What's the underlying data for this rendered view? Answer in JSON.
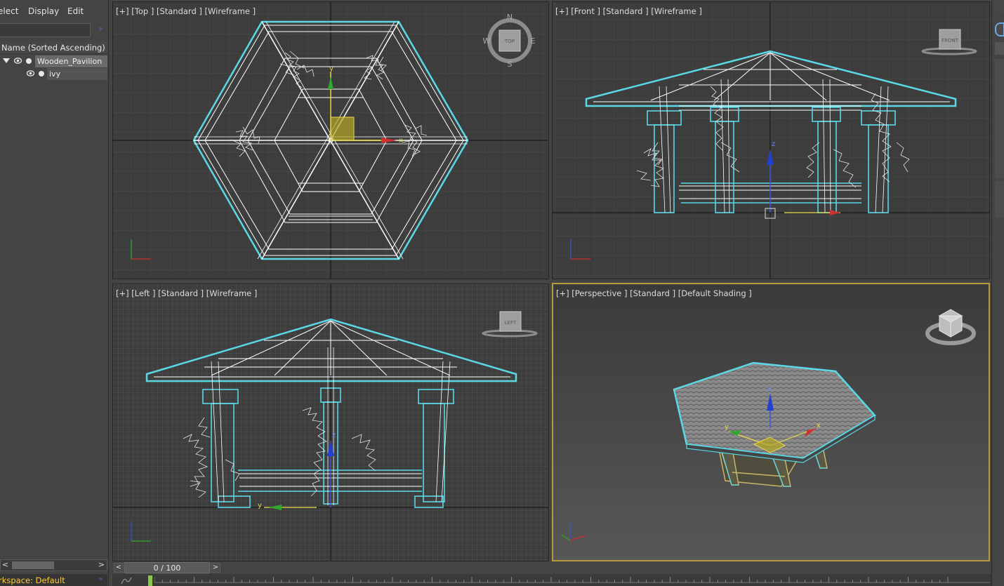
{
  "menu": {
    "select_label": "elect",
    "display_label": "Display",
    "edit_label": "Edit"
  },
  "explorer": {
    "column_header": "Name (Sorted Ascending)",
    "items": [
      {
        "label": "Wooden_Pavilion",
        "expanded": true
      },
      {
        "label": "ivy"
      }
    ]
  },
  "workspace": {
    "label": "rkspace: Default"
  },
  "viewports": {
    "top": {
      "label": "[+] [Top ] [Standard ] [Wireframe ]"
    },
    "front": {
      "label": "[+] [Front ] [Standard ] [Wireframe ]"
    },
    "left": {
      "label": "[+] [Left ] [Standard ] [Wireframe ]"
    },
    "perspective": {
      "label": "[+] [Perspective ] [Standard ] [Default Shading ]"
    }
  },
  "viewcube": {
    "top_face": "TOP",
    "front_face": "FRONT",
    "left_face": "LEFT",
    "compass": {
      "n": "N",
      "s": "S",
      "e": "E",
      "w": "W"
    }
  },
  "gizmo_labels": {
    "x": "x",
    "y": "y",
    "z": "z"
  },
  "timeline": {
    "frame_label": "0 / 100",
    "prev": "<",
    "next": ">"
  },
  "colors": {
    "selection": "#5ad8e6",
    "wire": "#ffffff",
    "active_border": "#b89a3a",
    "axis_x": "#d03030",
    "axis_y": "#2fa82f",
    "axis_z": "#2440d0",
    "workspace_text": "#ffcc33"
  }
}
